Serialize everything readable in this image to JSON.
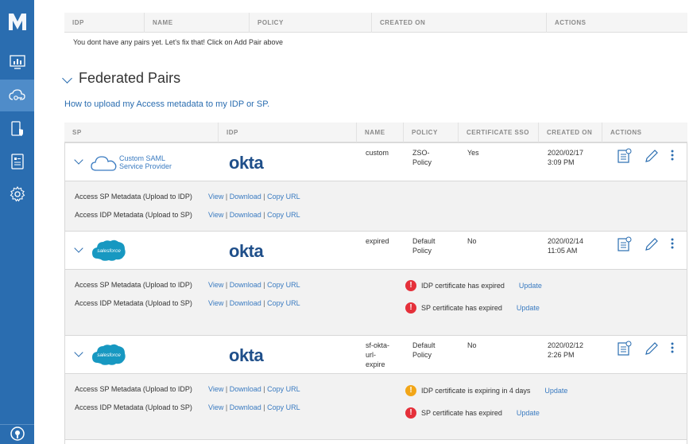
{
  "sidebar": {
    "logo": "M",
    "items": [
      {
        "icon": "monitor-chart-icon",
        "label": ""
      },
      {
        "icon": "cloud-key-icon",
        "label": ""
      },
      {
        "icon": "device-shield-icon",
        "label": ""
      },
      {
        "icon": "document-icon",
        "label": ""
      },
      {
        "icon": "gear-icon",
        "label": ""
      },
      {
        "icon": "bulb-icon",
        "label": ""
      }
    ],
    "accent": "#2a6db0",
    "active_color": "#4f8cc9"
  },
  "top_table": {
    "headers": [
      "IDP",
      "NAME",
      "POLICY",
      "CREATED ON",
      "ACTIONS"
    ],
    "empty_message": "You dont have any pairs yet. Let's fix that! Click on Add Pair above"
  },
  "federated": {
    "title": "Federated Pairs",
    "help_link": "How to upload my Access metadata to my IDP or SP.",
    "headers": [
      "SP",
      "IDP",
      "NAME",
      "POLICY",
      "CERTIFICATE SSO",
      "CREATED ON",
      "ACTIONS"
    ],
    "rows": [
      {
        "sp_logo": "custom-saml",
        "sp_text": [
          "Custom SAML",
          "Service Provider"
        ],
        "idp_logo": "okta",
        "name": [
          "custom"
        ],
        "policy": [
          "ZSO-",
          "Policy"
        ],
        "cert_sso": "Yes",
        "created": [
          "2020/02/17",
          "3:09 PM"
        ],
        "sp_meta_label": "Access SP Metadata (Upload to IDP)",
        "idp_meta_label": "Access IDP Metadata (Upload to SP)",
        "links": [
          "View",
          "Download",
          "Copy URL"
        ],
        "alerts": []
      },
      {
        "sp_logo": "salesforce",
        "sp_text": [
          "salesforce"
        ],
        "idp_logo": "okta",
        "name": [
          "expired"
        ],
        "policy": [
          "Default",
          "Policy"
        ],
        "cert_sso": "No",
        "created": [
          "2020/02/14",
          "11:05 AM"
        ],
        "sp_meta_label": "Access SP Metadata (Upload to IDP)",
        "idp_meta_label": "Access IDP Metadata (Upload to SP)",
        "links": [
          "View",
          "Download",
          "Copy URL"
        ],
        "alerts": [
          {
            "level": "error",
            "text": "IDP certificate has expired",
            "action": "Update"
          },
          {
            "level": "error",
            "text": "SP certificate has expired",
            "action": "Update"
          }
        ]
      },
      {
        "sp_logo": "salesforce",
        "sp_text": [
          "salesforce"
        ],
        "idp_logo": "okta",
        "name": [
          "sf-okta-",
          "url-",
          "expire"
        ],
        "policy": [
          "Default",
          "Policy"
        ],
        "cert_sso": "No",
        "created": [
          "2020/02/12",
          "2:26 PM"
        ],
        "sp_meta_label": "Access SP Metadata (Upload to IDP)",
        "idp_meta_label": "Access IDP Metadata (Upload to SP)",
        "links": [
          "View",
          "Download",
          "Copy URL"
        ],
        "alerts": [
          {
            "level": "warning",
            "text": "IDP certificate is expiring in 4 days",
            "action": "Update"
          },
          {
            "level": "error",
            "text": "SP certificate has expired",
            "action": "Update"
          }
        ]
      }
    ],
    "idp_logo_text": "okta",
    "colors": {
      "error": "#e5303a",
      "warning": "#f2a618",
      "link": "#3a7bc1"
    }
  }
}
